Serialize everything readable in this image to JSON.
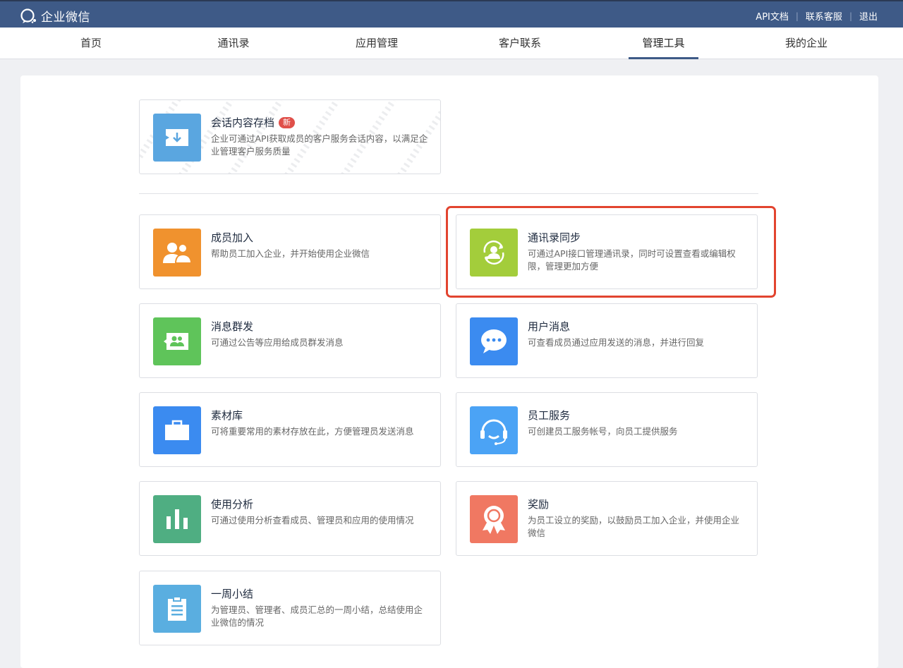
{
  "header": {
    "brand": "企业微信",
    "links": [
      "API文档",
      "联系客服",
      "退出"
    ]
  },
  "nav": {
    "tabs": [
      {
        "label": "首页"
      },
      {
        "label": "通讯录"
      },
      {
        "label": "应用管理"
      },
      {
        "label": "客户联系"
      },
      {
        "label": "管理工具",
        "active": true
      },
      {
        "label": "我的企业"
      }
    ]
  },
  "featured": {
    "title": "会话内容存档",
    "badge": "新",
    "desc": "企业可通过API获取成员的客户服务会话内容，以满足企业管理客户服务质量",
    "color": "#5aa6e0"
  },
  "tools": [
    {
      "title": "成员加入",
      "desc": "帮助员工加入企业，并开始使用企业微信",
      "color": "#f0922e",
      "icon": "users-icon"
    },
    {
      "title": "通讯录同步",
      "desc": "可通过API接口管理通讯录，同时可设置查看或编辑权限，管理更加方便",
      "color": "#a3cd3b",
      "icon": "contact-sync-icon"
    },
    {
      "title": "消息群发",
      "desc": "可通过公告等应用给成员群发消息",
      "color": "#5fc45a",
      "icon": "broadcast-icon"
    },
    {
      "title": "用户消息",
      "desc": "可查看成员通过应用发送的消息，并进行回复",
      "color": "#3b8bf0",
      "icon": "chat-bubble-icon"
    },
    {
      "title": "素材库",
      "desc": "可将重要常用的素材存放在此，方便管理员发送消息",
      "color": "#3b8bf0",
      "icon": "briefcase-icon"
    },
    {
      "title": "员工服务",
      "desc": "可创建员工服务帐号，向员工提供服务",
      "color": "#4ba3f5",
      "icon": "headset-icon"
    },
    {
      "title": "使用分析",
      "desc": "可通过使用分析查看成员、管理员和应用的使用情况",
      "color": "#4fae82",
      "icon": "bar-chart-icon"
    },
    {
      "title": "奖励",
      "desc": "为员工设立的奖励，以鼓励员工加入企业，并使用企业微信",
      "color": "#f07862",
      "icon": "award-icon"
    },
    {
      "title": "一周小结",
      "desc": "为管理员、管理者、成员汇总的一周小结，总结使用企业微信的情况",
      "color": "#5aaee0",
      "icon": "clipboard-icon"
    }
  ]
}
